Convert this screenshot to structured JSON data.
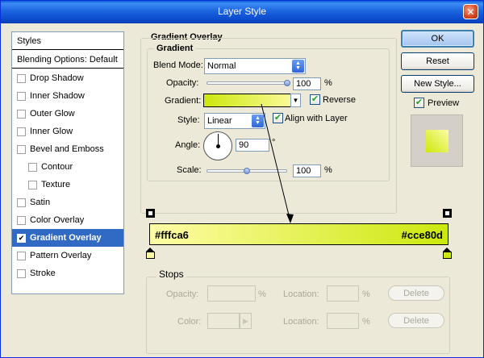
{
  "window": {
    "title": "Layer Style",
    "close_glyph": "✕"
  },
  "styles_list": {
    "header": "Styles",
    "blending": "Blending Options: Default",
    "items": [
      {
        "label": "Drop Shadow",
        "checked": false,
        "indent": false,
        "selected": false
      },
      {
        "label": "Inner Shadow",
        "checked": false,
        "indent": false,
        "selected": false
      },
      {
        "label": "Outer Glow",
        "checked": false,
        "indent": false,
        "selected": false
      },
      {
        "label": "Inner Glow",
        "checked": false,
        "indent": false,
        "selected": false
      },
      {
        "label": "Bevel and Emboss",
        "checked": false,
        "indent": false,
        "selected": false
      },
      {
        "label": "Contour",
        "checked": false,
        "indent": true,
        "selected": false
      },
      {
        "label": "Texture",
        "checked": false,
        "indent": true,
        "selected": false
      },
      {
        "label": "Satin",
        "checked": false,
        "indent": false,
        "selected": false
      },
      {
        "label": "Color Overlay",
        "checked": false,
        "indent": false,
        "selected": false
      },
      {
        "label": "Gradient Overlay",
        "checked": true,
        "indent": false,
        "selected": true
      },
      {
        "label": "Pattern Overlay",
        "checked": false,
        "indent": false,
        "selected": false
      },
      {
        "label": "Stroke",
        "checked": false,
        "indent": false,
        "selected": false
      }
    ]
  },
  "gradient_overlay": {
    "section_title": "Gradient Overlay",
    "group_title": "Gradient",
    "blend_mode_label": "Blend Mode:",
    "blend_mode_value": "Normal",
    "opacity_label": "Opacity:",
    "opacity_value": "100",
    "opacity_level": 1.0,
    "percent": "%",
    "gradient_label": "Gradient:",
    "reverse_label": "Reverse",
    "reverse_checked": true,
    "style_label": "Style:",
    "style_value": "Linear",
    "align_label": "Align with Layer",
    "align_checked": true,
    "angle_label": "Angle:",
    "angle_value": "90",
    "degree": "°",
    "scale_label": "Scale:",
    "scale_value": "100",
    "scale_level": 0.5
  },
  "buttons": {
    "ok": "OK",
    "reset": "Reset",
    "new_style": "New Style...",
    "preview_label": "Preview",
    "preview_checked": true
  },
  "gradient_editor": {
    "left_color": "#fffca6",
    "right_color": "#cce80d"
  },
  "stops": {
    "title": "Stops",
    "opacity_label": "Opacity:",
    "location_label": "Location:",
    "color_label": "Color:",
    "percent": "%",
    "delete": "Delete"
  }
}
